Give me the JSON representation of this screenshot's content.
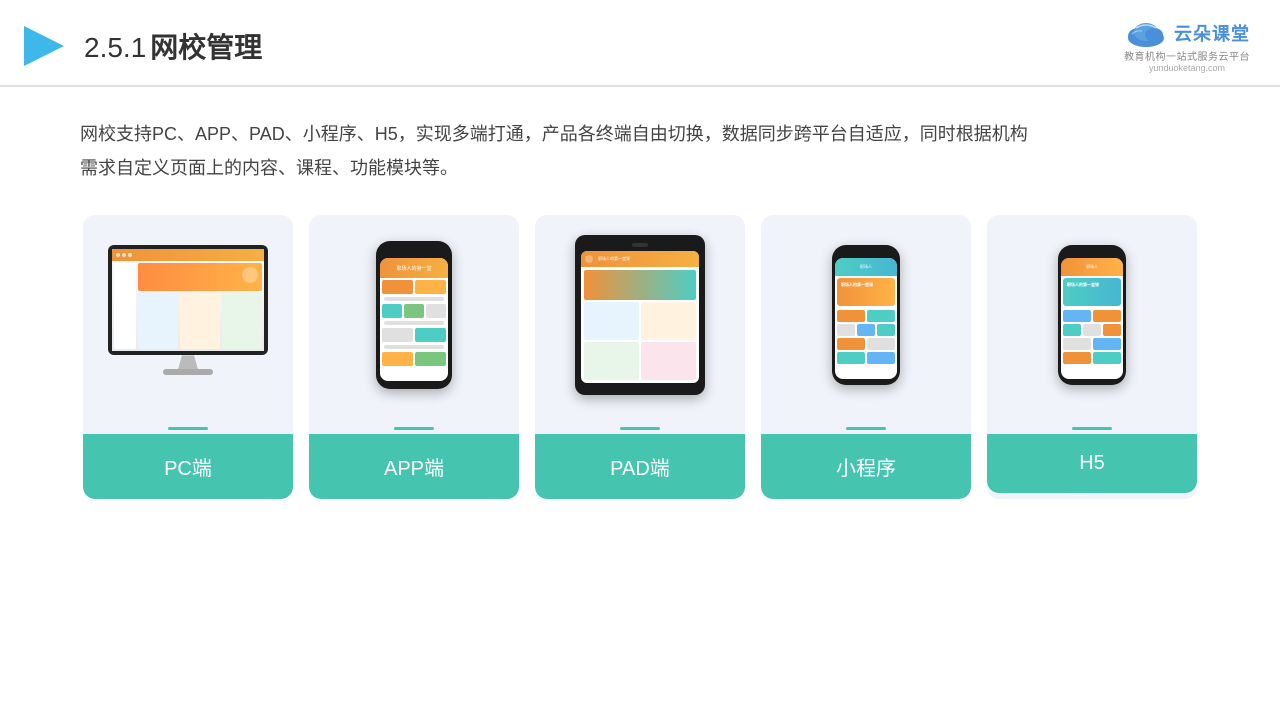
{
  "header": {
    "title": "网校管理",
    "title_number": "2.5.1",
    "logo_text": "云朵课堂",
    "logo_url": "yunduoketang.com",
    "logo_sub": "教育机构一站式服务云平台"
  },
  "description": {
    "line1": "网校支持PC、APP、PAD、小程序、H5，实现多端打通，产品各终端自由切换，数据同步跨平台自适应，同时根据机构",
    "line2": "需求自定义页面上的内容、课程、功能模块等。"
  },
  "cards": [
    {
      "label": "PC端",
      "type": "pc"
    },
    {
      "label": "APP端",
      "type": "phone"
    },
    {
      "label": "PAD端",
      "type": "tablet"
    },
    {
      "label": "小程序",
      "type": "mini-phone"
    },
    {
      "label": "H5",
      "type": "h5-phone"
    }
  ],
  "brand_color": "#45c4b0"
}
